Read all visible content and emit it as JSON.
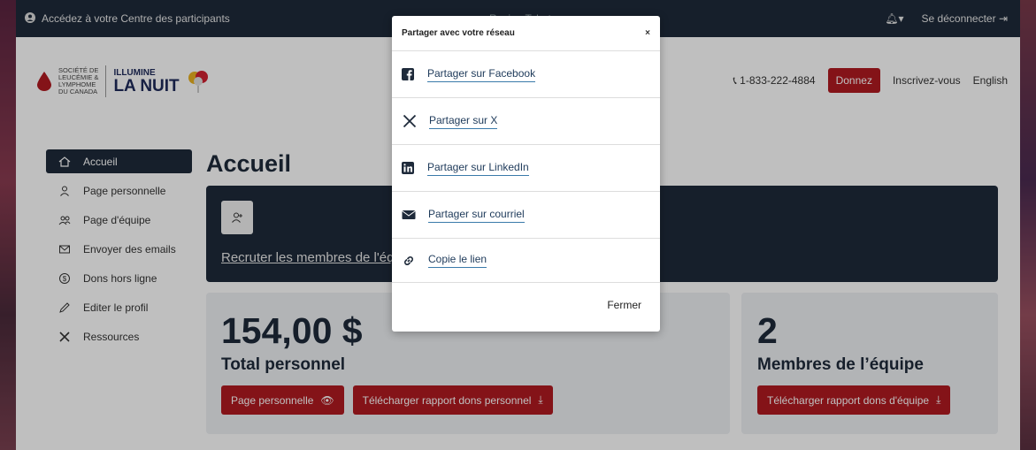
{
  "topbar": {
    "access": "Accédez à votre Centre des participants",
    "center": "Rosine Tabot",
    "logout": "Se déconnecter"
  },
  "logo": {
    "org_line1": "Société de",
    "org_line2": "Leucémie &",
    "org_line3": "Lymphome",
    "org_line4": "du Canada",
    "brand_top": "ILLUMINE",
    "brand_bottom": "LA NUIT"
  },
  "header": {
    "phone": "1-833-222-4884",
    "donate": "Donnez",
    "register": "Inscrivez-vous",
    "language": "English"
  },
  "sidebar": {
    "items": [
      {
        "label": "Accueil",
        "icon": "home-icon"
      },
      {
        "label": "Page personnelle",
        "icon": "user-icon"
      },
      {
        "label": "Page d'équipe",
        "icon": "team-icon"
      },
      {
        "label": "Envoyer des emails",
        "icon": "mail-icon"
      },
      {
        "label": "Dons hors ligne",
        "icon": "dollar-icon"
      },
      {
        "label": "Editer le profil",
        "icon": "edit-icon"
      },
      {
        "label": "Ressources",
        "icon": "tools-icon"
      }
    ]
  },
  "main": {
    "title": "Accueil",
    "recruit_link": "Recruter les membres de l'équipe et partagez avec votre réseau",
    "personal": {
      "amount": "154,00 $",
      "label": "Total personnel",
      "btn_page": "Page personnelle",
      "btn_report": "Télécharger rapport dons personnel"
    },
    "team": {
      "count": "2",
      "label": "Membres de l’équipe",
      "btn_report": "Télécharger rapport dons d'équipe"
    }
  },
  "modal": {
    "title": "Partager avec votre réseau",
    "close": "×",
    "items": [
      {
        "label": "Partager sur Facebook",
        "icon": "facebook-icon"
      },
      {
        "label": "Partager sur X",
        "icon": "x-icon"
      },
      {
        "label": "Partager sur LinkedIn",
        "icon": "linkedin-icon"
      },
      {
        "label": "Partager sur courriel",
        "icon": "envelope-icon"
      },
      {
        "label": "Copie le lien",
        "icon": "link-icon"
      }
    ],
    "footer": "Fermer"
  },
  "colors": {
    "navy": "#1e2a3a",
    "red": "#b01a20"
  }
}
